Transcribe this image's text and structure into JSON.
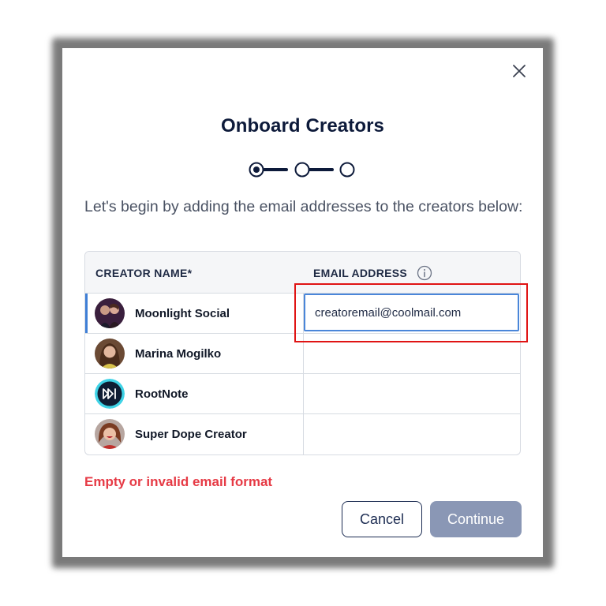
{
  "dialog": {
    "title": "Onboard Creators",
    "intro": "Let's begin by adding the email addresses to the creators below:",
    "close_icon": "close-icon",
    "stepper": {
      "total_steps": 3,
      "current_step": 1
    }
  },
  "table": {
    "headers": {
      "name": "CREATOR NAME*",
      "email": "EMAIL ADDRESS"
    },
    "info_icon": "info-icon",
    "rows": [
      {
        "name": "Moonlight Social",
        "email": "creatoremail@coolmail.com",
        "avatar": "avatar-photo"
      },
      {
        "name": "Marina Mogilko",
        "email": "",
        "avatar": "avatar-photo"
      },
      {
        "name": "RootNote",
        "email": "",
        "avatar": "play-logo-icon"
      },
      {
        "name": "Super Dope Creator",
        "email": "",
        "avatar": "avatar-photo"
      }
    ]
  },
  "error": {
    "message": "Empty or invalid email format",
    "color": "#e63a45"
  },
  "buttons": {
    "cancel": "Cancel",
    "continue": "Continue"
  },
  "colors": {
    "primary": "#1c2c52",
    "accent": "#4a86d9",
    "disabled": "#8a97b5",
    "highlight": "#e01414"
  }
}
